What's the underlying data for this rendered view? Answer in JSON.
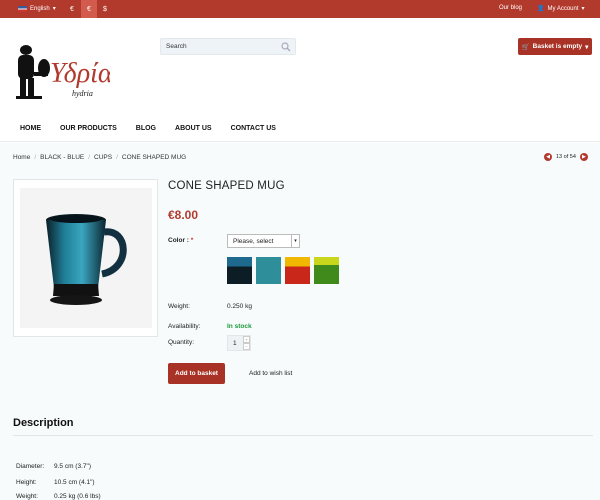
{
  "topbar": {
    "language": "English",
    "currencies": [
      "€",
      "€",
      "$"
    ],
    "blog_link": "Our blog",
    "account": "My Account"
  },
  "header": {
    "logo_text": "Υδρία",
    "logo_subtext": "hydria",
    "search_placeholder": "Search",
    "basket_label": "Basket is empty"
  },
  "nav": [
    "HOME",
    "OUR PRODUCTS",
    "BLOG",
    "ABOUT US",
    "CONTACT US"
  ],
  "breadcrumb": [
    "Home",
    "BLACK - BLUE",
    "CUPS",
    "CONE SHAPED MUG"
  ],
  "pager": {
    "text": "13 of 54"
  },
  "product": {
    "title": "CONE SHAPED MUG",
    "price": "€8.00",
    "color_label": "Color :",
    "required_mark": "*",
    "color_select": "Please, select",
    "swatch_colors": [
      "#1e6a8f",
      "#2e8f9b",
      "#c8271a",
      "#3f8a1b"
    ],
    "weight_label": "Weight:",
    "weight_value": "0.250 kg",
    "availability_label": "Availability:",
    "availability_value": "In stock",
    "quantity_label": "Quantity:",
    "quantity_value": "1",
    "add_to_basket": "Add to basket",
    "add_to_wishlist": "Add to wish list"
  },
  "description": {
    "title": "Description",
    "specs": [
      {
        "label": "Diameter:",
        "value": "9.5 cm (3.7\")"
      },
      {
        "label": "Height:",
        "value": "10.5 cm (4.1\")"
      },
      {
        "label": "Weight:",
        "value": "0.25 kg (0.6 lbs)"
      }
    ]
  },
  "colors": {
    "brand": "#b23a2d",
    "in_stock": "#1a9a3a"
  }
}
